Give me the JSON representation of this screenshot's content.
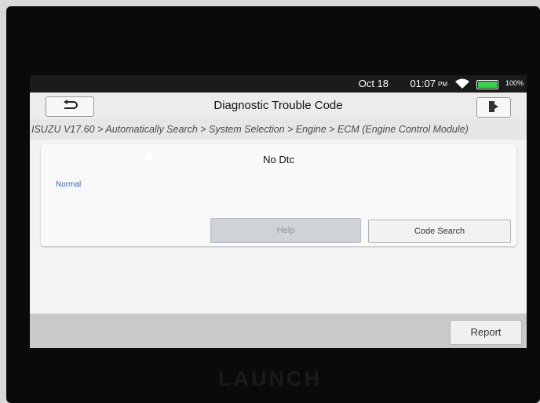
{
  "status_bar": {
    "date": "Oct 18",
    "time": "01:07",
    "ampm": "PM",
    "battery": "100%",
    "wifi_icon": "wifi-icon",
    "battery_icon": "battery-icon",
    "battery_level": 1.0,
    "battery_color": "#2fd44a"
  },
  "header": {
    "title": "Diagnostic Trouble Code",
    "back_icon": "back-arrow-icon",
    "exit_icon": "exit-door-icon"
  },
  "breadcrumb": {
    "path": "ISUZU V17.60 > Automatically Search > System Selection > Engine > ECM (Engine Control Module)"
  },
  "result": {
    "title": "No Dtc",
    "status": "Normal",
    "status_color": "#3a68c8"
  },
  "actions": {
    "help_label": "Help",
    "code_search_label": "Code Search",
    "report_label": "Report"
  },
  "device": {
    "brand": "LAUNCH"
  }
}
